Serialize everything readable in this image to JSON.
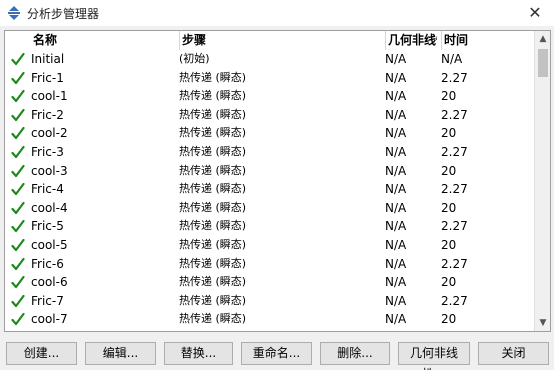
{
  "window": {
    "title": "分析步管理器",
    "close_glyph": "✕"
  },
  "table": {
    "headers": {
      "name": "名称",
      "step": "步骤",
      "nlgeom": "几何非线性",
      "time": "时间"
    },
    "rows": [
      {
        "checked": true,
        "name": "Initial",
        "step": "(初始)",
        "nlgeom": "N/A",
        "time": "N/A"
      },
      {
        "checked": true,
        "name": "Fric-1",
        "step": "热传递 (瞬态)",
        "nlgeom": "N/A",
        "time": "2.27"
      },
      {
        "checked": true,
        "name": "cool-1",
        "step": "热传递 (瞬态)",
        "nlgeom": "N/A",
        "time": "20"
      },
      {
        "checked": true,
        "name": "Fric-2",
        "step": "热传递 (瞬态)",
        "nlgeom": "N/A",
        "time": "2.27"
      },
      {
        "checked": true,
        "name": "cool-2",
        "step": "热传递 (瞬态)",
        "nlgeom": "N/A",
        "time": "20"
      },
      {
        "checked": true,
        "name": "Fric-3",
        "step": "热传递 (瞬态)",
        "nlgeom": "N/A",
        "time": "2.27"
      },
      {
        "checked": true,
        "name": "cool-3",
        "step": "热传递 (瞬态)",
        "nlgeom": "N/A",
        "time": "20"
      },
      {
        "checked": true,
        "name": "Fric-4",
        "step": "热传递 (瞬态)",
        "nlgeom": "N/A",
        "time": "2.27"
      },
      {
        "checked": true,
        "name": "cool-4",
        "step": "热传递 (瞬态)",
        "nlgeom": "N/A",
        "time": "20"
      },
      {
        "checked": true,
        "name": "Fric-5",
        "step": "热传递 (瞬态)",
        "nlgeom": "N/A",
        "time": "2.27"
      },
      {
        "checked": true,
        "name": "cool-5",
        "step": "热传递 (瞬态)",
        "nlgeom": "N/A",
        "time": "20"
      },
      {
        "checked": true,
        "name": "Fric-6",
        "step": "热传递 (瞬态)",
        "nlgeom": "N/A",
        "time": "2.27"
      },
      {
        "checked": true,
        "name": "cool-6",
        "step": "热传递 (瞬态)",
        "nlgeom": "N/A",
        "time": "20"
      },
      {
        "checked": true,
        "name": "Fric-7",
        "step": "热传递 (瞬态)",
        "nlgeom": "N/A",
        "time": "2.27"
      },
      {
        "checked": true,
        "name": "cool-7",
        "step": "热传递 (瞬态)",
        "nlgeom": "N/A",
        "time": "20"
      }
    ]
  },
  "scrollbar": {
    "up_glyph": "▲",
    "down_glyph": "▼"
  },
  "buttons": {
    "create": "创建...",
    "edit": "编辑...",
    "replace": "替换...",
    "rename": "重命名...",
    "delete": "删除...",
    "nlgeom": "几何非线性...",
    "close": "关闭"
  },
  "colors": {
    "check": "#1e8a1e",
    "icon": "#3a6fb5"
  },
  "icons": {
    "title": "step-manager-icon",
    "check": "checkmark-icon"
  }
}
